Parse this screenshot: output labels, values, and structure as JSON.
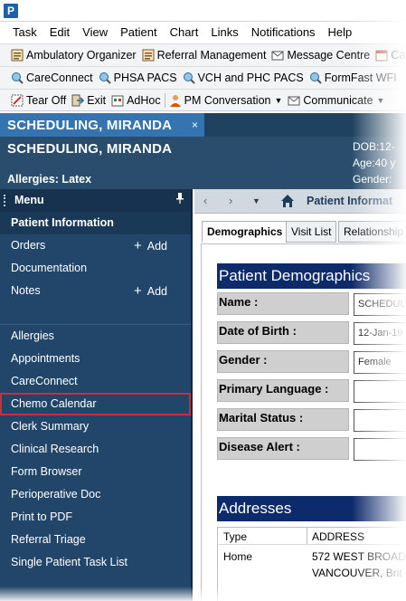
{
  "app": {
    "icon_letter": "P"
  },
  "menubar": [
    "Task",
    "Edit",
    "View",
    "Patient",
    "Chart",
    "Links",
    "Notifications",
    "Help"
  ],
  "toolbar1": [
    {
      "label": "Ambulatory Organizer",
      "icon": "organizer-icon"
    },
    {
      "label": "Referral Management",
      "icon": "referral-icon"
    },
    {
      "label": "Message Centre",
      "icon": "message-icon"
    },
    {
      "label": "Ca",
      "icon": "calendar-icon"
    }
  ],
  "toolbar2": [
    {
      "label": "CareConnect",
      "icon": "globe-search-icon"
    },
    {
      "label": "PHSA PACS",
      "icon": "globe-search-icon"
    },
    {
      "label": "VCH and PHC PACS",
      "icon": "globe-search-icon"
    },
    {
      "label": "FormFast WFI",
      "icon": "globe-search-icon"
    }
  ],
  "toolbar3": {
    "tear_off": "Tear Off",
    "exit": "Exit",
    "adhoc": "AdHoc",
    "pm_conversation": "PM Conversation",
    "communicate": "Communicate"
  },
  "banner": {
    "tab_label": "SCHEDULING, MIRANDA",
    "close": "×",
    "name": "SCHEDULING, MIRANDA",
    "allergies": "Allergies: Latex",
    "dob": "DOB:12-",
    "age": "Age:40 y",
    "gender": "Gender:"
  },
  "sidebar": {
    "title": "Menu",
    "items": [
      {
        "label": "Patient Information",
        "active": true
      },
      {
        "label": "Orders",
        "add": "Add"
      },
      {
        "label": "Documentation"
      },
      {
        "label": "Notes",
        "add": "Add"
      },
      {
        "label": ""
      },
      {
        "label": "Allergies"
      },
      {
        "label": "Appointments"
      },
      {
        "label": "CareConnect"
      },
      {
        "label": "Chemo Calendar",
        "highlight": true
      },
      {
        "label": "Clerk Summary"
      },
      {
        "label": "Clinical Research"
      },
      {
        "label": "Form Browser"
      },
      {
        "label": "Perioperative Doc"
      },
      {
        "label": "Print to PDF"
      },
      {
        "label": "Referral Triage"
      },
      {
        "label": "Single Patient Task List"
      }
    ]
  },
  "content": {
    "title": "Patient Informat",
    "tabs": [
      "Demographics",
      "Visit List",
      "Relationship"
    ],
    "demographics": {
      "heading": "Patient Demographics",
      "fields": [
        {
          "label": "Name :",
          "value": "SCHEDUL"
        },
        {
          "label": "Date of Birth :",
          "value": "12-Jan-19"
        },
        {
          "label": "Gender :",
          "value": "Female"
        },
        {
          "label": "Primary Language :",
          "value": ""
        },
        {
          "label": "Marital Status :",
          "value": ""
        },
        {
          "label": "Disease Alert :",
          "value": ""
        }
      ]
    },
    "addresses": {
      "heading": "Addresses",
      "columns": [
        "Type",
        "ADDRESS"
      ],
      "rows": [
        {
          "type": "Home",
          "address_line1": "572 WEST BROADW",
          "address_line2": "VANCOUVER, Brit"
        }
      ]
    }
  },
  "colors": {
    "banner_bg": "#2a4d6e",
    "patient_tab": "#3474b1",
    "sidebar_bg": "#22466a",
    "section_head": "#0d2a6b",
    "highlight_outline": "#c7303b"
  }
}
